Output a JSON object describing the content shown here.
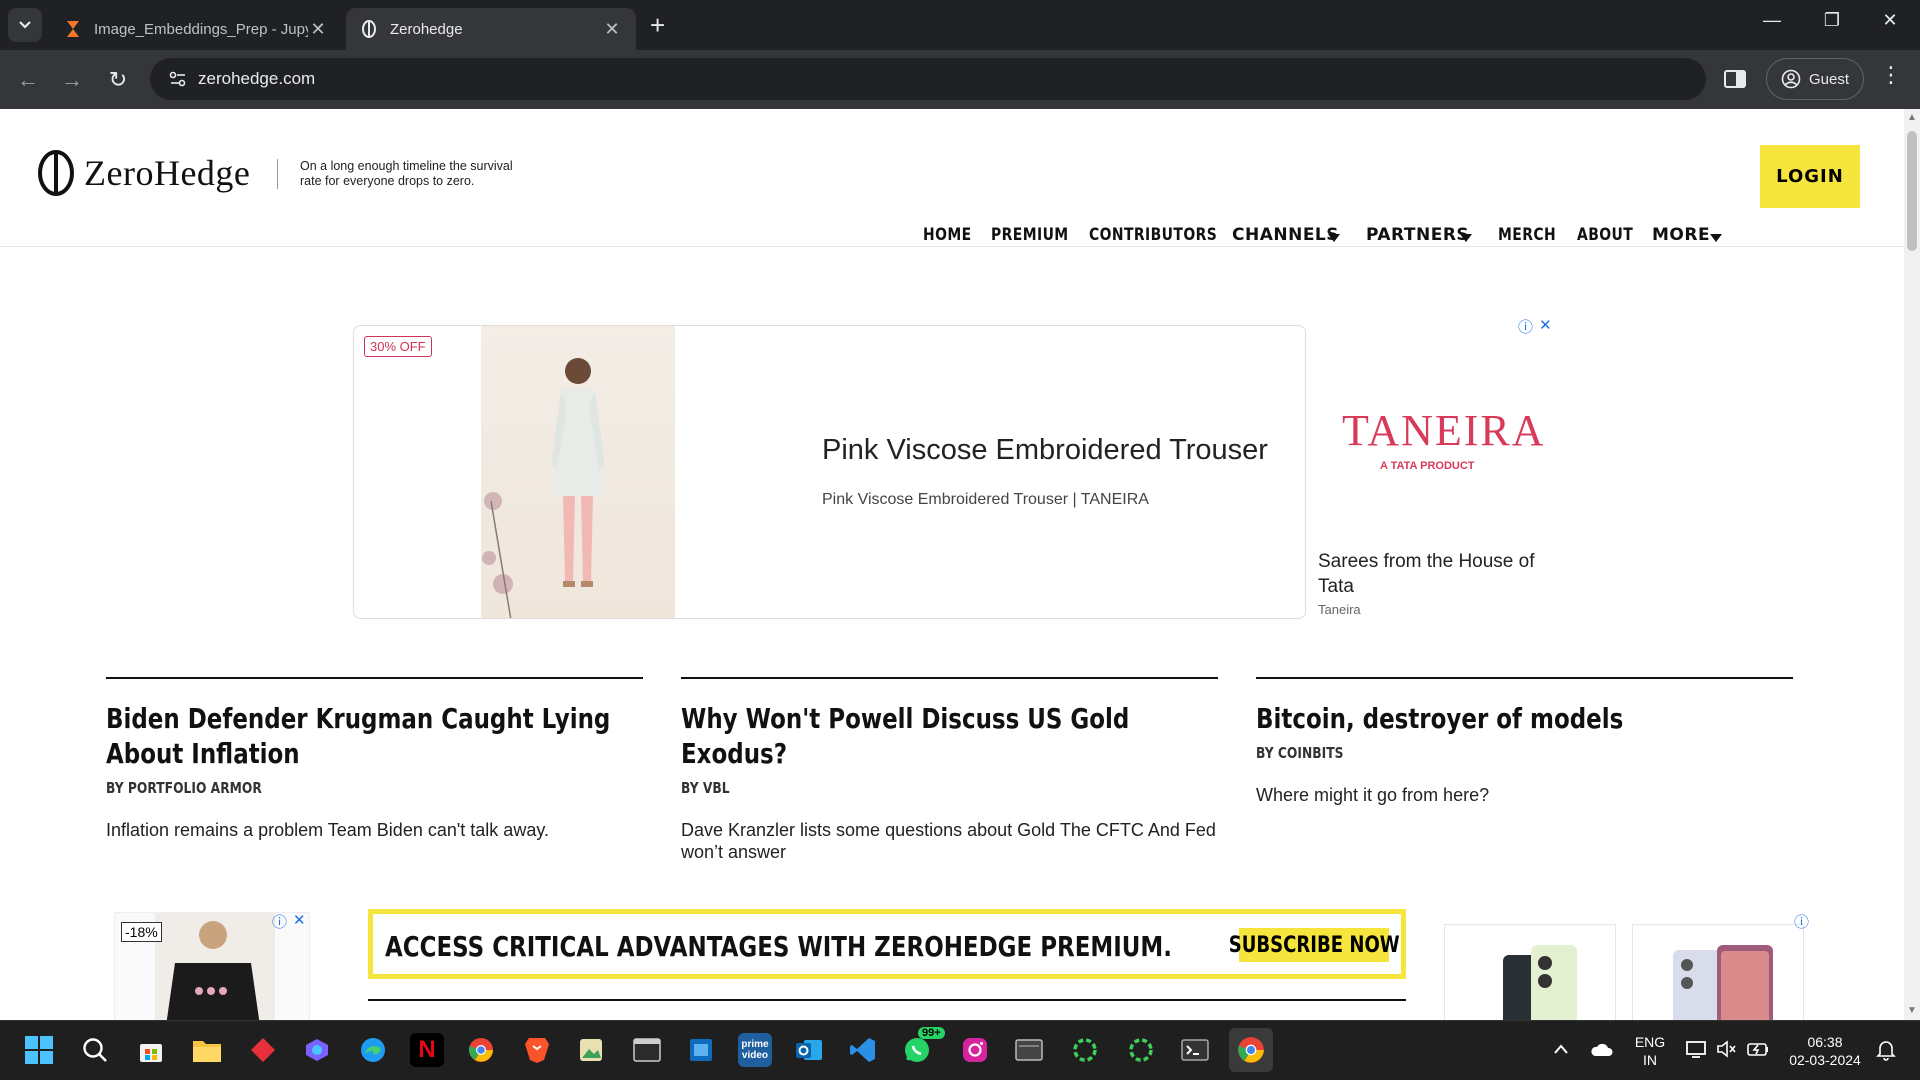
{
  "browser": {
    "tabs": [
      {
        "title": "Image_Embeddings_Prep - Jupy",
        "active": false,
        "icon": "hourglass-icon"
      },
      {
        "title": "Zerohedge",
        "active": true,
        "icon": "zerohedge-icon"
      }
    ],
    "url": "zerohedge.com",
    "profile_label": "Guest"
  },
  "site": {
    "logo_text": "ZeroHedge",
    "tagline": "On a long enough timeline the survival rate for everyone drops to zero.",
    "nav": [
      "HOME",
      "PREMIUM",
      "CONTRIBUTORS",
      "CHANNELS",
      "PARTNERS",
      "MERCH",
      "ABOUT",
      "MORE"
    ],
    "login_label": "LOGIN"
  },
  "ad_top": {
    "badge": "30% OFF",
    "headline": "Pink Viscose Embroidered Trouser",
    "subline": "Pink Viscose Embroidered Trouser | TANEIRA",
    "brand": "TANEIRA",
    "brand_sub": "A TATA PRODUCT",
    "description": "Sarees from the House of Tata",
    "advertiser": "Taneira"
  },
  "articles": [
    {
      "title": "Biden Defender Krugman Caught Lying About Inflation",
      "byline": "BY PORTFOLIO ARMOR",
      "teaser": "Inflation remains a problem Team Biden can't talk away."
    },
    {
      "title": "Why Won't Powell Discuss US Gold Exodus?",
      "byline": "BY VBL",
      "teaser": "Dave Kranzler lists some questions about Gold The CFTC And Fed won’t answer"
    },
    {
      "title": "Bitcoin, destroyer of models",
      "byline": "BY COINBITS",
      "teaser": "Where might it go from here?"
    }
  ],
  "ad_left": {
    "badge": "-18%"
  },
  "promo": {
    "message": "ACCESS CRITICAL ADVANTAGES WITH ZEROHEDGE PREMIUM.",
    "cta": "SUBSCRIBE NOW"
  },
  "taskbar": {
    "whatsapp_badge": "99+",
    "lang_top": "ENG",
    "lang_bottom": "IN",
    "time": "06:38",
    "date": "02-03-2024"
  }
}
